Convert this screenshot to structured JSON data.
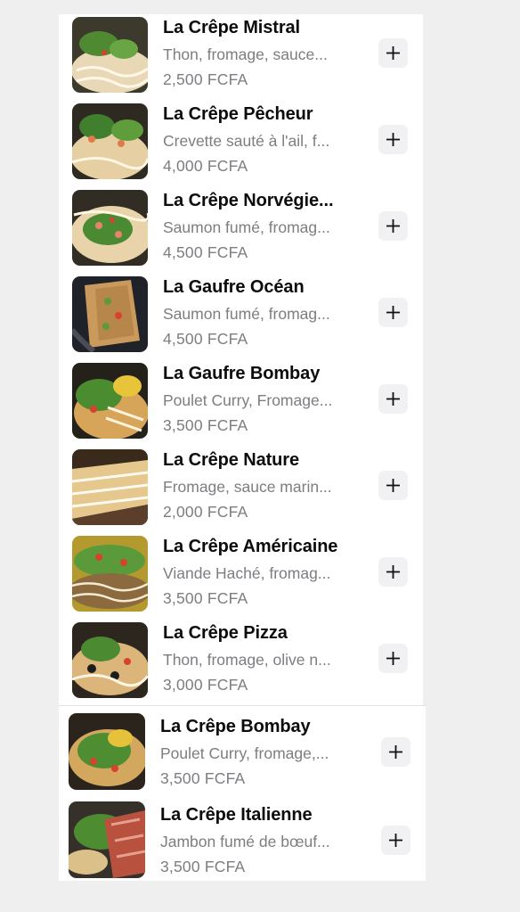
{
  "menu_items": [
    {
      "name": "La Crêpe Mistral",
      "description": "Thon, fromage, sauce...",
      "price": "2,500 FCFA",
      "add_label": "+"
    },
    {
      "name": "La Crêpe Pêcheur",
      "description": "Crevette sauté à l'ail, f...",
      "price": "4,000 FCFA",
      "add_label": "+"
    },
    {
      "name": "La Crêpe Norvégie...",
      "description": "Saumon fumé, fromag...",
      "price": "4,500 FCFA",
      "add_label": "+"
    },
    {
      "name": "La Gaufre Océan",
      "description": "Saumon fumé, fromag...",
      "price": "4,500 FCFA",
      "add_label": "+"
    },
    {
      "name": "La Gaufre Bombay",
      "description": "Poulet Curry, Fromage...",
      "price": "3,500 FCFA",
      "add_label": "+"
    },
    {
      "name": "La Crêpe Nature",
      "description": "Fromage, sauce marin...",
      "price": "2,000 FCFA",
      "add_label": "+"
    },
    {
      "name": "La Crêpe Américaine",
      "description": "Viande Haché, fromag...",
      "price": "3,500 FCFA",
      "add_label": "+"
    },
    {
      "name": "La Crêpe Pizza",
      "description": "Thon, fromage, olive n...",
      "price": "3,000 FCFA",
      "add_label": "+"
    },
    {
      "name": "La Crêpe Bombay",
      "description": "Poulet Curry, fromage,...",
      "price": "3,500 FCFA",
      "add_label": "+"
    },
    {
      "name": "La Crêpe Italienne",
      "description": "Jambon fumé de bœuf...",
      "price": "3,500 FCFA",
      "add_label": "+"
    }
  ],
  "icons": {
    "add": "plus-icon",
    "thumbnail": "food-photo"
  },
  "colors": {
    "background": "#efeff0",
    "card": "#ffffff",
    "title": "#0c0c0c",
    "secondary_text": "#7d7d82",
    "button_bg": "#f1f1f3"
  }
}
